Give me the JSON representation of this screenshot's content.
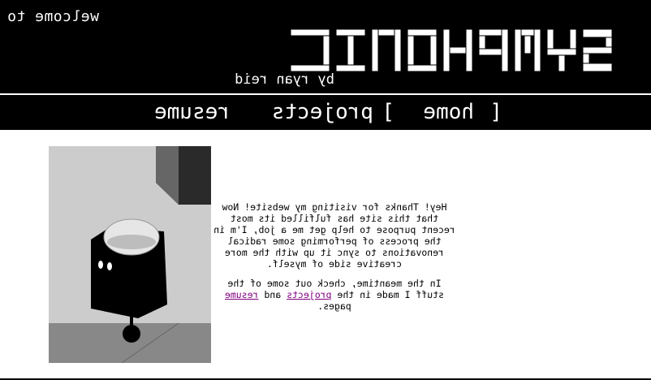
{
  "header": {
    "welcome": "welcome to",
    "logo_text": "SYMPHONIC",
    "byline": "by ryan reid"
  },
  "nav": {
    "open_bracket": "[",
    "home": "home",
    "close_bracket": "]",
    "projects": "projects",
    "resume": "resume"
  },
  "content": {
    "intro": "Hey! Thanks for visiting my website! Now that this site has fulfilled its most recent purpose to help get me a job, I'm in the process of performing some radical renovations to sync it up with the more creative side of myself.",
    "meantime_prefix": "In the meantime, check out some of the stuff I made in the",
    "projects_link": "projects",
    "and": "and",
    "resume_link": "resume",
    "suffix": "pages."
  },
  "colors": {
    "header_bg": "#000000",
    "link": "#800080",
    "gray_light": "#cccccc",
    "gray_mid": "#888888",
    "gray_dark": "#555555"
  }
}
